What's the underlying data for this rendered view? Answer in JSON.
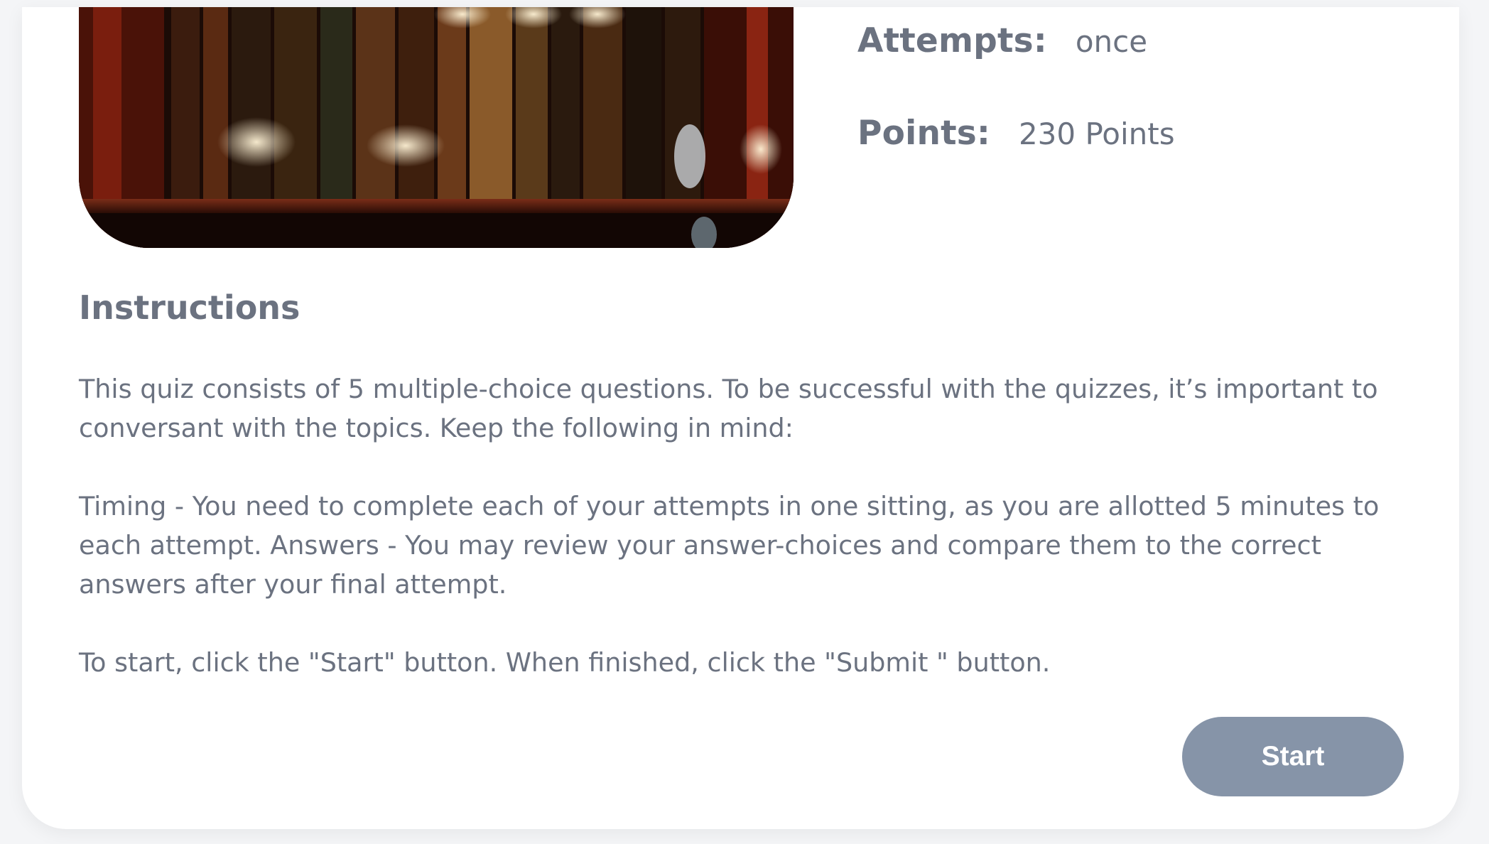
{
  "quiz_info": {
    "attempts_label": "Attempts:",
    "attempts_value": "once",
    "points_label": "Points:",
    "points_value": "230 Points"
  },
  "instructions": {
    "title": "Instructions",
    "paragraphs": [
      "This quiz consists of 5 multiple-choice questions. To be successful with the quizzes, it’s important to conversant with the topics. Keep the following in mind:",
      "Timing - You need to complete each of your attempts in one sitting, as you are allotted 5 minutes to each attempt. Answers - You may review your answer-choices and compare them to the correct answers after your final attempt.",
      "To start, click the \"Start\" button. When finished, click the \"Submit \" button."
    ]
  },
  "actions": {
    "start_label": "Start"
  },
  "colors": {
    "text": "#6b7280",
    "button": "#8694a8",
    "card": "#ffffff"
  }
}
